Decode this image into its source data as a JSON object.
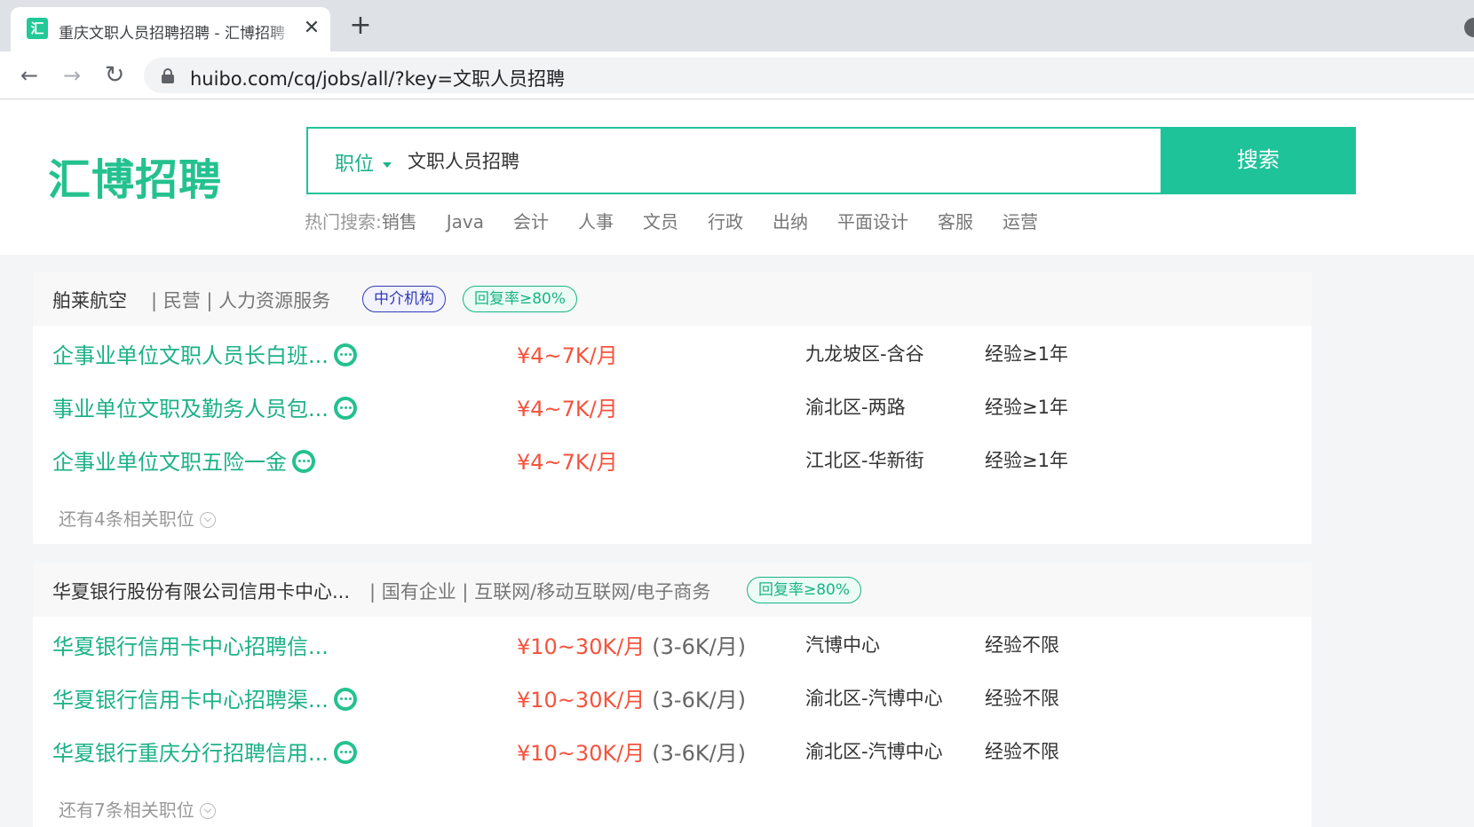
{
  "browser": {
    "tab_title": "重庆文职人员招聘招聘 - 汇博招聘",
    "favicon_glyph": "汇",
    "url": "huibo.com/cq/jobs/all/?key=文职人员招聘"
  },
  "site": {
    "logo": "汇博招聘",
    "search": {
      "category": "职位",
      "query": "文职人员招聘",
      "button": "搜索"
    },
    "hot_search": {
      "label": "热门搜索:",
      "items": [
        "销售",
        "Java",
        "会计",
        "人事",
        "文员",
        "行政",
        "出纳",
        "平面设计",
        "客服",
        "运营"
      ]
    }
  },
  "colors": {
    "brand": "#1fc39a",
    "salary": "#f5533d",
    "agency_badge": "#2f3ab2"
  },
  "companies": [
    {
      "name": "舶莱航空",
      "meta": "| 民营 | 人力资源服务",
      "badges": [
        "中介机构",
        "回复率≥80%"
      ],
      "jobs": [
        {
          "title": "企事业单位文职人员长白班...",
          "chat": true,
          "salary": "¥4~7K/月",
          "salary_extra": "",
          "location": "九龙坡区-含谷",
          "experience": "经验≥1年"
        },
        {
          "title": "事业单位文职及勤务人员包...",
          "chat": true,
          "salary": "¥4~7K/月",
          "salary_extra": "",
          "location": "渝北区-两路",
          "experience": "经验≥1年"
        },
        {
          "title": "企事业单位文职五险一金",
          "chat": true,
          "salary": "¥4~7K/月",
          "salary_extra": "",
          "location": "江北区-华新街",
          "experience": "经验≥1年"
        }
      ],
      "more": "还有4条相关职位"
    },
    {
      "name": "华夏银行股份有限公司信用卡中心...",
      "meta": "| 国有企业 | 互联网/移动互联网/电子商务",
      "badges": [
        "回复率≥80%"
      ],
      "jobs": [
        {
          "title": "华夏银行信用卡中心招聘信...",
          "chat": false,
          "salary": "¥10~30K/月",
          "salary_extra": "(3-6K/月)",
          "location": "汽博中心",
          "experience": "经验不限"
        },
        {
          "title": "华夏银行信用卡中心招聘渠...",
          "chat": true,
          "salary": "¥10~30K/月",
          "salary_extra": "(3-6K/月)",
          "location": "渝北区-汽博中心",
          "experience": "经验不限"
        },
        {
          "title": "华夏银行重庆分行招聘信用...",
          "chat": true,
          "salary": "¥10~30K/月",
          "salary_extra": "(3-6K/月)",
          "location": "渝北区-汽博中心",
          "experience": "经验不限"
        }
      ],
      "more": "还有7条相关职位"
    }
  ]
}
